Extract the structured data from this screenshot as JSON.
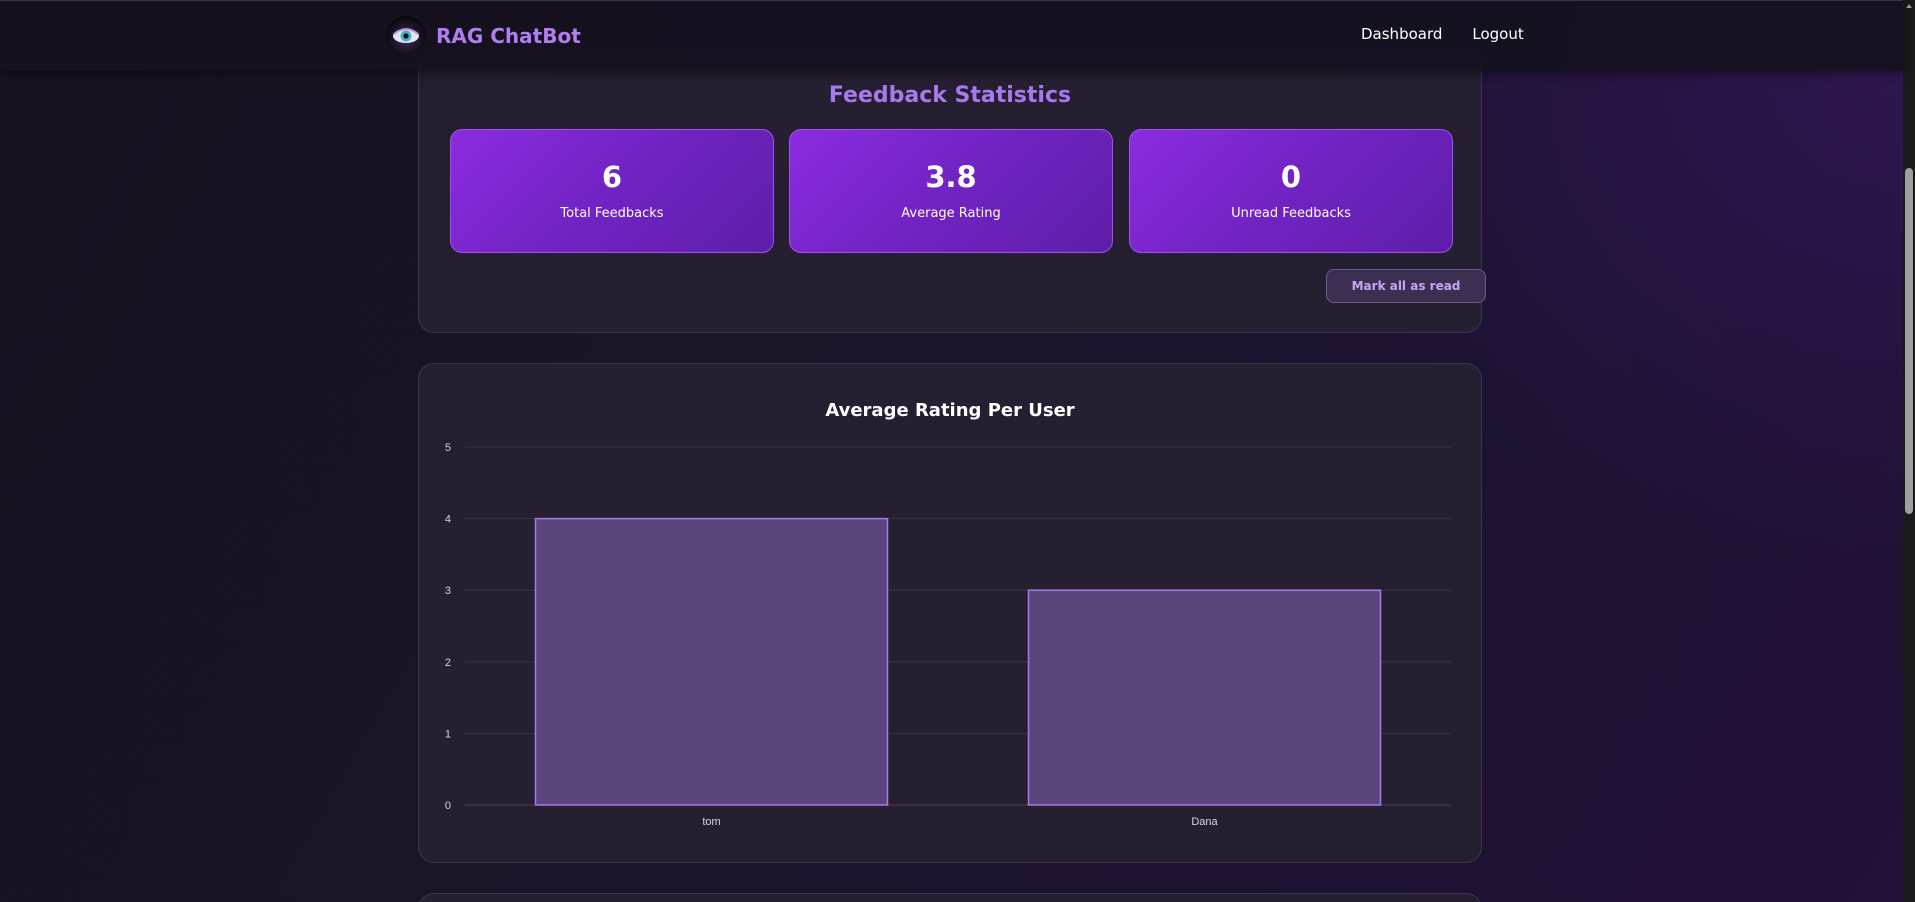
{
  "app": {
    "brand": "RAG ChatBot"
  },
  "nav": {
    "dashboard": "Dashboard",
    "logout": "Logout"
  },
  "stats": {
    "title": "Feedback Statistics",
    "items": [
      {
        "value": "6",
        "label": "Total Feedbacks"
      },
      {
        "value": "3.8",
        "label": "Average Rating"
      },
      {
        "value": "0",
        "label": "Unread Feedbacks"
      }
    ],
    "mark_all_read": "Mark all as read"
  },
  "chart_data": {
    "type": "bar",
    "title": "Average Rating Per User",
    "categories": [
      "tom",
      "Dana"
    ],
    "values": [
      4,
      3
    ],
    "ylim": [
      0,
      5
    ],
    "yticks": [
      "0",
      "1",
      "2",
      "3",
      "4",
      "5"
    ],
    "grid": true,
    "legend": "none",
    "xlabel": "",
    "ylabel": "",
    "bar_fill": "#5a467c",
    "bar_stroke": "#a27de8"
  },
  "colors": {
    "accent": "#a879ec",
    "card_border": "#3b3450"
  }
}
